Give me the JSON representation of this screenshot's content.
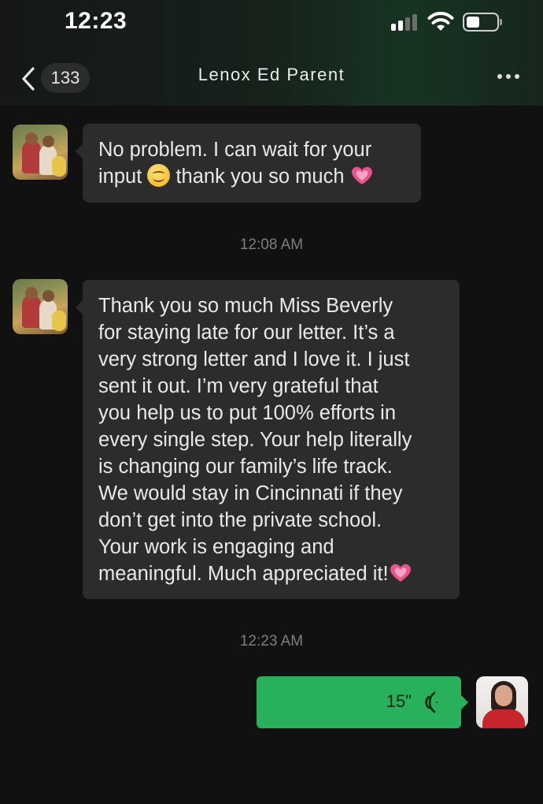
{
  "status_bar": {
    "time": "12:23",
    "signal_icon": "cellular-signal-icon",
    "wifi_icon": "wifi-icon",
    "battery_icon": "battery-icon"
  },
  "header": {
    "back_icon": "chevron-left-icon",
    "unread_count": "133",
    "title": "Lenox Ed Parent",
    "more_icon": "more-dots-icon",
    "background_color": "#16201a"
  },
  "messages": [
    {
      "sender": "contact",
      "avatar_icon": "family-photo-avatar",
      "lines": [
        "No problem. I can wait for your",
        "input ",
        " thank you so much "
      ],
      "emojis": [
        "smiling-face-emoji",
        "pink-heart-emoji"
      ]
    },
    {
      "sender": "contact",
      "avatar_icon": "family-photo-avatar",
      "lines": [
        "Thank you so much Miss Beverly",
        "for staying late for our letter. It’s a",
        "very strong letter and I love it. I just",
        "sent it out. I’m very grateful that",
        "you help us to put 100% efforts in",
        "every single step. Your help literally",
        "is changing our family’s life track.",
        "We would stay in Cincinnati if they",
        "don’t get into the private school.",
        "Your work is engaging and",
        "meaningful. Much appreciated it!"
      ],
      "emojis": [
        "pink-heart-emoji"
      ]
    },
    {
      "sender": "me",
      "type": "voice",
      "duration": "15\"",
      "voice_icon": "voice-wave-icon",
      "avatar_icon": "self-portrait-avatar"
    }
  ],
  "timestamps": [
    "12:08 AM",
    "12:23 AM"
  ],
  "colors": {
    "background": "#111111",
    "incoming_bubble": "#2c2c2c",
    "outgoing_bubble": "#28b15a",
    "timestamp_text": "#7e7e7e",
    "heart": "#e8538f"
  }
}
